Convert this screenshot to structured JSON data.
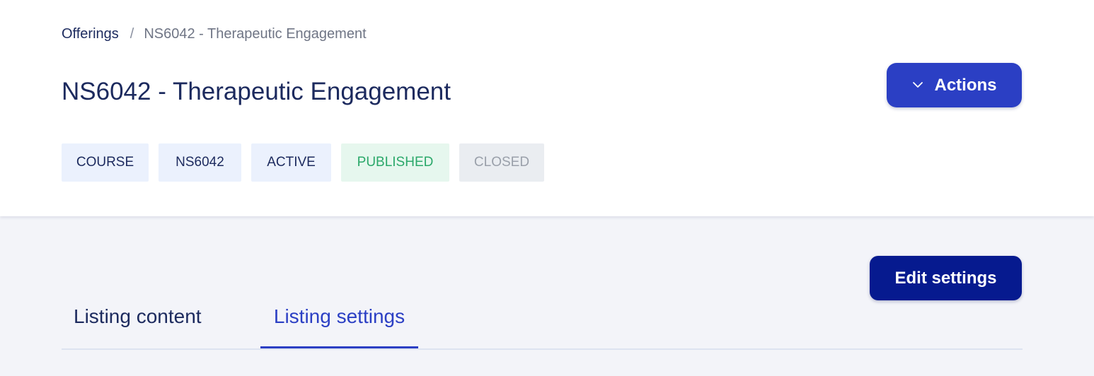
{
  "breadcrumb": {
    "parent_label": "Offerings",
    "separator": "/",
    "current_label": "NS6042 - Therapeutic Engagement"
  },
  "page": {
    "title": "NS6042 - Therapeutic Engagement"
  },
  "actions_menu": {
    "label": "Actions",
    "icon": "chevron-down-icon"
  },
  "badges": [
    {
      "label": "COURSE"
    },
    {
      "label": "NS6042"
    },
    {
      "label": "ACTIVE"
    },
    {
      "label": "PUBLISHED",
      "color": "#2ba86a"
    },
    {
      "label": "CLOSED",
      "color": "#9aa0aa"
    }
  ],
  "settings": {
    "edit_label": "Edit settings"
  },
  "tabs": [
    {
      "label": "Listing content",
      "active": false
    },
    {
      "label": "Listing settings",
      "active": true
    }
  ],
  "colors": {
    "primary": "#2b3fc4",
    "primary_dark": "#061a8f",
    "text": "#1c2a5e",
    "background": "#f3f4f9"
  }
}
